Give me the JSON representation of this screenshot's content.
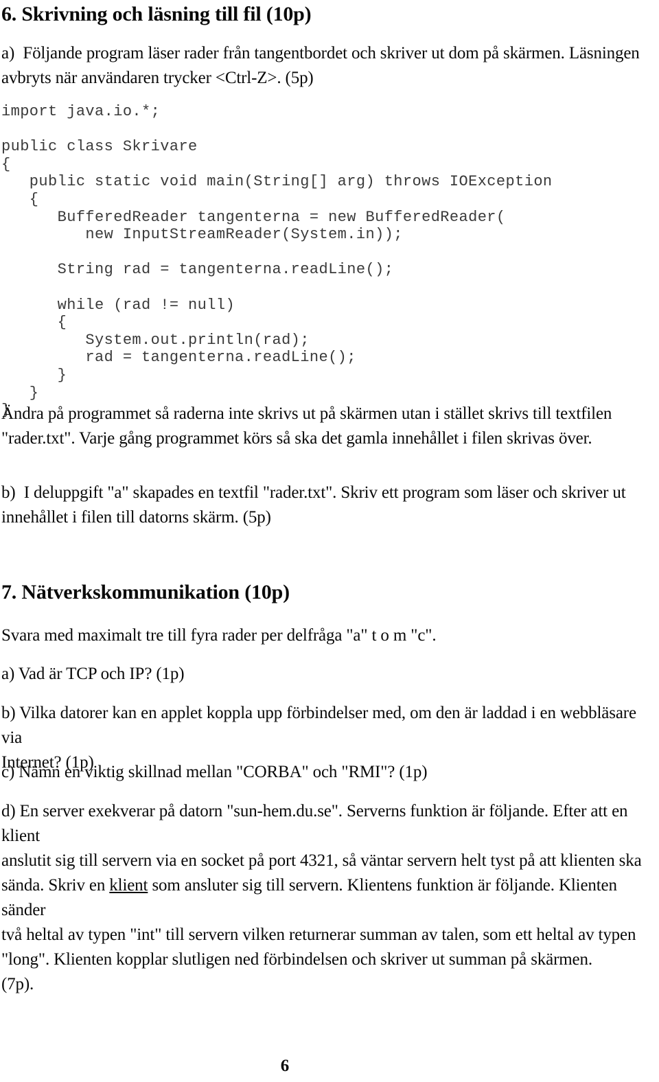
{
  "document": {
    "language": "sv",
    "page_number": "6",
    "text_color": "#0a0a0a",
    "code_color": "#3a3a3a",
    "background": "#ffffff"
  },
  "section6": {
    "heading": "6. Skrivning och läsning till fil (10p)",
    "part_a": {
      "line1": "a)  Följande program läser rader från tangentbordet och skriver ut dom på skärmen. Läsningen",
      "line2": "avbryts när användaren trycker <Ctrl-Z>. (5p)"
    },
    "code": [
      "import java.io.*;",
      "",
      "public class Skrivare",
      "{",
      "   public static void main(String[] arg) throws IOException",
      "   {",
      "      BufferedReader tangenterna = new BufferedReader(",
      "         new InputStreamReader(System.in));",
      "",
      "      String rad = tangenterna.readLine();",
      "",
      "      while (rad != null)",
      "      {",
      "         System.out.println(rad);",
      "         rad = tangenterna.readLine();",
      "      }",
      "   }",
      "}"
    ],
    "instruction": {
      "line1": "Ändra på programmet så raderna inte skrivs ut på skärmen utan i stället skrivs till textfilen",
      "line2": "\"rader.txt\". Varje gång programmet körs så ska det gamla innehållet i filen skrivas över."
    },
    "part_b": {
      "line1": "b)  I deluppgift \"a\" skapades en textfil \"rader.txt\". Skriv ett program som läser och skriver ut",
      "line2": "innehållet i filen till datorns skärm. (5p)"
    }
  },
  "section7": {
    "heading": "7. Nätverkskommunikation (10p)",
    "intro": "Svara med maximalt tre till fyra rader per delfråga \"a\" t o m \"c\".",
    "part_a": "a) Vad är TCP och IP? (1p)",
    "part_b": {
      "line1": "b) Vilka datorer kan en applet koppla upp förbindelser med, om den är laddad i en webbläsare via",
      "line2": "Internet? (1p)"
    },
    "part_c": "c) Nämn en viktig skillnad mellan \"CORBA\" och \"RMI\"? (1p)",
    "part_d": {
      "line1": "d) En server exekverar på datorn \"sun-hem.du.se\". Serverns funktion är följande. Efter att en klient",
      "line2": "anslutit sig till servern via en socket på port 4321, så väntar servern helt tyst på att klienten ska",
      "line3_pre": "sända. Skriv en ",
      "line3_underlined": "klient",
      "line3_post": " som ansluter sig till servern. Klientens funktion är följande. Klienten sänder",
      "line4": "två heltal av typen \"int\" till servern vilken returnerar summan av talen, som ett heltal av typen",
      "line5": "\"long\". Klienten kopplar slutligen ned förbindelsen och skriver ut summan på skärmen.",
      "line6": "(7p)."
    }
  }
}
